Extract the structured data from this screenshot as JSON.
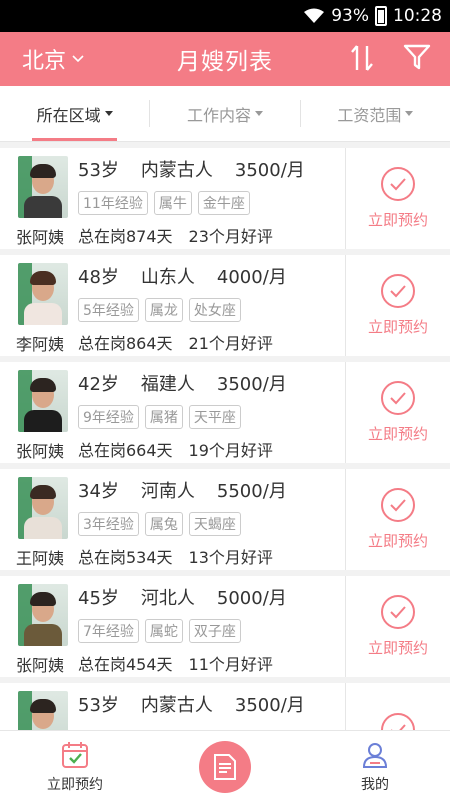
{
  "status": {
    "battery": "93%",
    "time": "10:28"
  },
  "header": {
    "city": "北京",
    "title": "月嫂列表"
  },
  "filters": [
    {
      "label": "所在区域",
      "active": true
    },
    {
      "label": "工作内容",
      "active": false
    },
    {
      "label": "工资范围",
      "active": false
    }
  ],
  "book_label": "立即预约",
  "nannies": [
    {
      "name": "张阿姨",
      "age": "53岁",
      "origin": "内蒙古人",
      "salary": "3500/月",
      "tags": [
        "11年经验",
        "属牛",
        "金牛座"
      ],
      "days": "总在岗874天",
      "reviews": "23个月好评"
    },
    {
      "name": "李阿姨",
      "age": "48岁",
      "origin": "山东人",
      "salary": "4000/月",
      "tags": [
        "5年经验",
        "属龙",
        "处女座"
      ],
      "days": "总在岗864天",
      "reviews": "21个月好评"
    },
    {
      "name": "张阿姨",
      "age": "42岁",
      "origin": "福建人",
      "salary": "3500/月",
      "tags": [
        "9年经验",
        "属猪",
        "天平座"
      ],
      "days": "总在岗664天",
      "reviews": "19个月好评"
    },
    {
      "name": "王阿姨",
      "age": "34岁",
      "origin": "河南人",
      "salary": "5500/月",
      "tags": [
        "3年经验",
        "属兔",
        "天蝎座"
      ],
      "days": "总在岗534天",
      "reviews": "13个月好评"
    },
    {
      "name": "张阿姨",
      "age": "45岁",
      "origin": "河北人",
      "salary": "5000/月",
      "tags": [
        "7年经验",
        "属蛇",
        "双子座"
      ],
      "days": "总在岗454天",
      "reviews": "11个月好评"
    },
    {
      "name": "",
      "age": "53岁",
      "origin": "内蒙古人",
      "salary": "3500/月",
      "tags": [
        "",
        "",
        ""
      ],
      "days": "",
      "reviews": ""
    }
  ],
  "tabbar": {
    "left": "立即预约",
    "right": "我的"
  },
  "colors": {
    "accent": "#f47c86"
  }
}
